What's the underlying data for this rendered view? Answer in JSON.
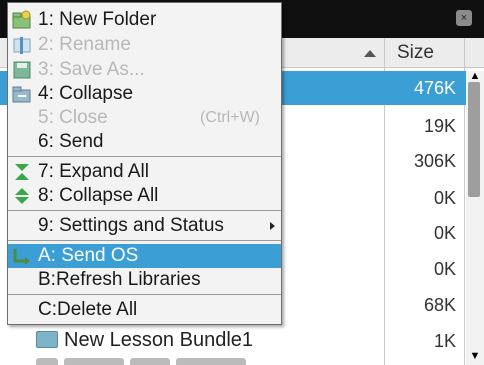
{
  "file_browser": {
    "columns": {
      "size": "Size"
    },
    "size_values": [
      "476K",
      "19K",
      "306K",
      "0K",
      "0K",
      "0K",
      "68K",
      "1K"
    ],
    "bottom_item": "New Lesson Bundle1"
  },
  "context_menu": {
    "items": [
      {
        "label": "1: New Folder",
        "enabled": true
      },
      {
        "label": "2: Rename",
        "enabled": false
      },
      {
        "label": "3: Save As...",
        "enabled": false
      },
      {
        "label": "4: Collapse",
        "enabled": true
      },
      {
        "label": "5: Close",
        "shortcut": "(Ctrl+W)",
        "enabled": false
      },
      {
        "label": "6: Send",
        "enabled": true
      },
      {
        "label": "7: Expand All",
        "enabled": true
      },
      {
        "label": "8: Collapse All",
        "enabled": true
      },
      {
        "label": "9: Settings and Status",
        "enabled": true
      },
      {
        "label": "A: Send OS",
        "enabled": true,
        "highlighted": true
      },
      {
        "label": "B:Refresh Libraries",
        "enabled": true
      },
      {
        "label": "C:Delete All",
        "enabled": true
      }
    ]
  },
  "colors": {
    "selection": "#3b9fd6",
    "topbar": "#0f0f0f"
  }
}
